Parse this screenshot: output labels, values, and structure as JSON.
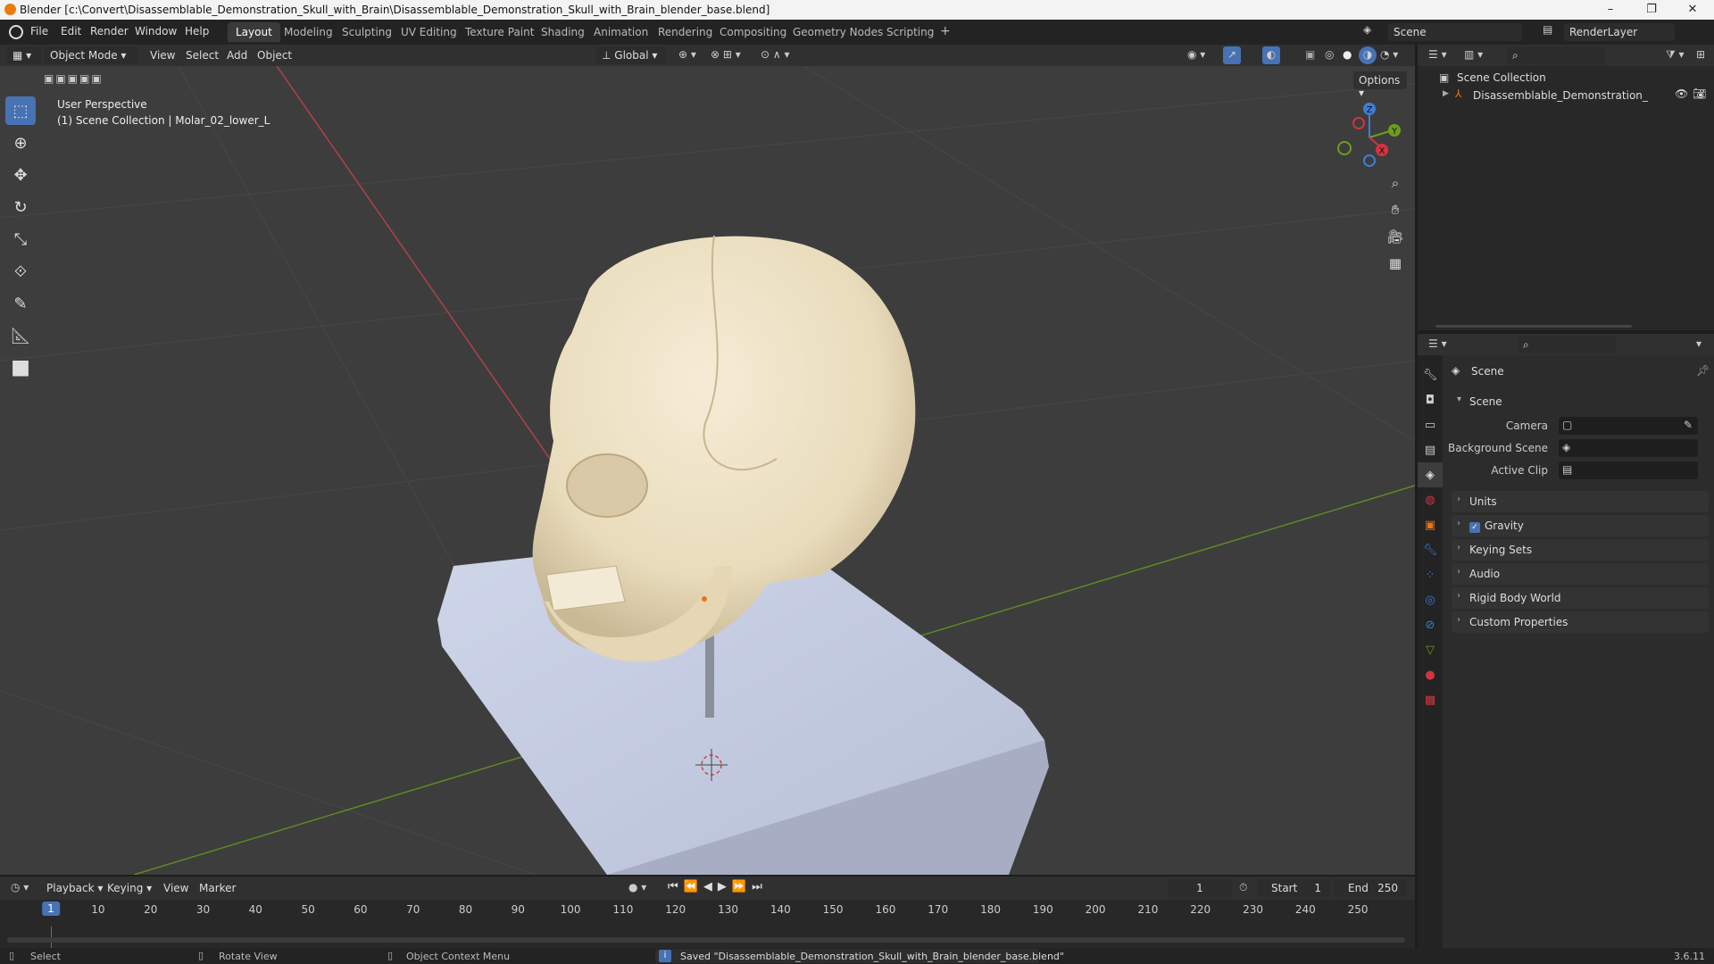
{
  "window": {
    "title": "Blender [c:\\Convert\\Disassemblable_Demonstration_Skull_with_Brain\\Disassemblable_Demonstration_Skull_with_Brain_blender_base.blend]"
  },
  "menubar": {
    "items": [
      "File",
      "Edit",
      "Render",
      "Window",
      "Help"
    ]
  },
  "workspaces": [
    "Layout",
    "Modeling",
    "Sculpting",
    "UV Editing",
    "Texture Paint",
    "Shading",
    "Animation",
    "Rendering",
    "Compositing",
    "Geometry Nodes",
    "Scripting"
  ],
  "active_workspace": "Layout",
  "scene_selector": "Scene",
  "view_layer_selector": "RenderLayer",
  "viewport_header": {
    "mode": "Object Mode",
    "menus": [
      "View",
      "Select",
      "Add",
      "Object"
    ],
    "orientation": "Global",
    "options_label": "Options"
  },
  "viewport_overlay": {
    "line1": "User Perspective",
    "line2": "(1) Scene Collection | Molar_02_lower_L"
  },
  "gizmo_axes": {
    "x": "X",
    "y": "Y",
    "z": "Z"
  },
  "outliner": {
    "root": "Scene Collection",
    "item": "Disassemblable_Demonstration_Skull_w"
  },
  "properties": {
    "header": "Scene",
    "section": "Scene",
    "fields": [
      {
        "label": "Camera"
      },
      {
        "label": "Background Scene"
      },
      {
        "label": "Active Clip"
      }
    ],
    "panels": [
      "Units",
      "Gravity",
      "Keying Sets",
      "Audio",
      "Rigid Body World",
      "Custom Properties"
    ],
    "gravity_checked": true
  },
  "timeline": {
    "menus": [
      "Playback",
      "Keying",
      "View",
      "Marker"
    ],
    "current_frame": "1",
    "start_label": "Start",
    "start": "1",
    "end_label": "End",
    "end": "250",
    "ticks": [
      "1",
      "10",
      "20",
      "30",
      "40",
      "50",
      "60",
      "70",
      "80",
      "90",
      "100",
      "110",
      "120",
      "130",
      "140",
      "150",
      "160",
      "170",
      "180",
      "190",
      "200",
      "210",
      "220",
      "230",
      "240",
      "250"
    ]
  },
  "statusbar": {
    "select": "Select",
    "rotate": "Rotate View",
    "context_menu": "Object Context Menu",
    "message": "Saved \"Disassemblable_Demonstration_Skull_with_Brain_blender_base.blend\"",
    "version": "3.6.11"
  },
  "colors": {
    "accent": "#4772b3",
    "x_axis": "#d0343f",
    "y_axis": "#6c9e1f",
    "z_axis": "#3e7fd6"
  }
}
